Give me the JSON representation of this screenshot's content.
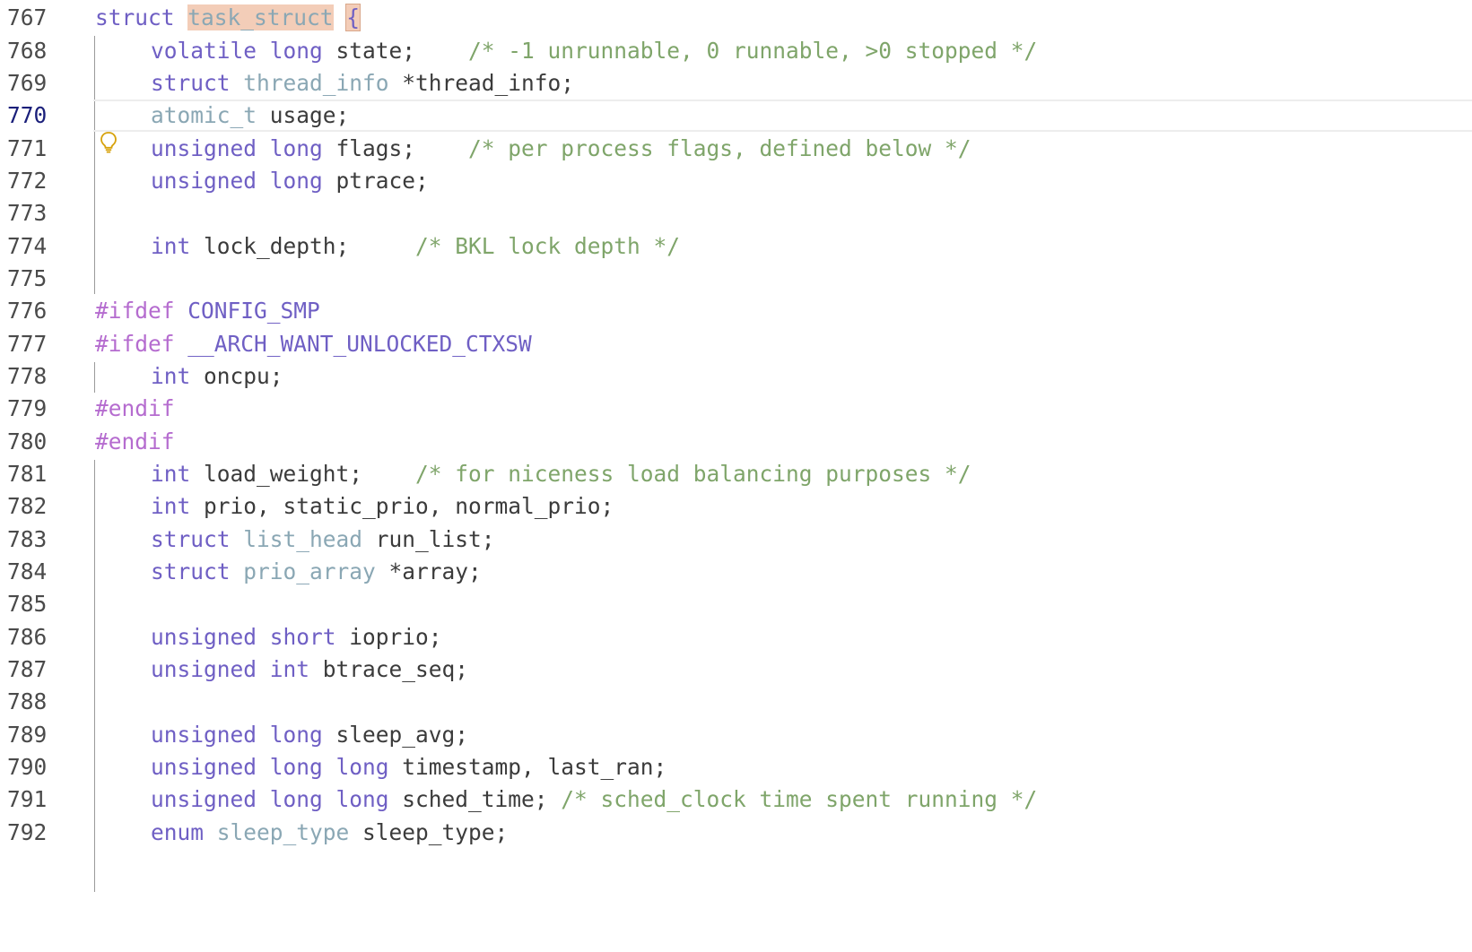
{
  "colors": {
    "keyword": "#6f5fc4",
    "type": "#8aa7b4",
    "comment": "#7fa56a",
    "preprocessor": "#b56ccf",
    "highlight": "#f3cdb8",
    "line_number": "#4a4a4a",
    "current_line_number": "#1a1f7a"
  },
  "current_line": "770",
  "lines": [
    {
      "num": "767",
      "t": [
        "struct ",
        "task_struct",
        " ",
        "{"
      ]
    },
    {
      "num": "768",
      "t": [
        "volatile long",
        " state;    ",
        "/* -1 unrunnable, 0 runnable, >0 stopped */"
      ]
    },
    {
      "num": "769",
      "t": [
        "struct ",
        "thread_info",
        " *thread_info;"
      ]
    },
    {
      "num": "770",
      "t": [
        "atomic_t",
        " usage;"
      ]
    },
    {
      "num": "771",
      "t": [
        "unsigned long",
        " flags;    ",
        "/* per process flags, defined below */"
      ]
    },
    {
      "num": "772",
      "t": [
        "unsigned long",
        " ptrace;"
      ]
    },
    {
      "num": "773",
      "t": []
    },
    {
      "num": "774",
      "t": [
        "int",
        " lock_depth;     ",
        "/* BKL lock depth */"
      ]
    },
    {
      "num": "775",
      "t": []
    },
    {
      "num": "776",
      "t": [
        "#ifdef ",
        "CONFIG_SMP"
      ]
    },
    {
      "num": "777",
      "t": [
        "#ifdef ",
        "__ARCH_WANT_UNLOCKED_CTXSW"
      ]
    },
    {
      "num": "778",
      "t": [
        "int",
        " oncpu;"
      ]
    },
    {
      "num": "779",
      "t": [
        "#endif"
      ]
    },
    {
      "num": "780",
      "t": [
        "#endif"
      ]
    },
    {
      "num": "781",
      "t": [
        "int",
        " load_weight;    ",
        "/* for niceness load balancing purposes */"
      ]
    },
    {
      "num": "782",
      "t": [
        "int",
        " prio, static_prio, normal_prio;"
      ]
    },
    {
      "num": "783",
      "t": [
        "struct ",
        "list_head",
        " run_list;"
      ]
    },
    {
      "num": "784",
      "t": [
        "struct ",
        "prio_array",
        " *array;"
      ]
    },
    {
      "num": "785",
      "t": []
    },
    {
      "num": "786",
      "t": [
        "unsigned short",
        " ioprio;"
      ]
    },
    {
      "num": "787",
      "t": [
        "unsigned int",
        " btrace_seq;"
      ]
    },
    {
      "num": "788",
      "t": []
    },
    {
      "num": "789",
      "t": [
        "unsigned long",
        " sleep_avg;"
      ]
    },
    {
      "num": "790",
      "t": [
        "unsigned long long",
        " timestamp, last_ran;"
      ]
    },
    {
      "num": "791",
      "t": [
        "unsigned long long",
        " sched_time; ",
        "/* sched_clock time spent running */"
      ]
    },
    {
      "num": "792",
      "t": [
        "enum ",
        "sleep_type",
        " sleep_type;"
      ]
    }
  ],
  "icons": {
    "lightbulb": "lightbulb-icon"
  }
}
